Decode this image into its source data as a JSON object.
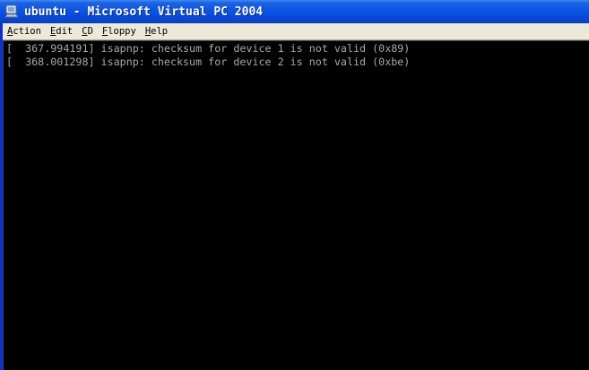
{
  "window": {
    "title": "ubuntu - Microsoft Virtual PC 2004",
    "app_icon": "virtual-pc-icon"
  },
  "menubar": {
    "items": [
      {
        "accel": "A",
        "rest": "ction"
      },
      {
        "accel": "E",
        "rest": "dit"
      },
      {
        "accel": "C",
        "rest": "D"
      },
      {
        "accel": "F",
        "rest": "loppy"
      },
      {
        "accel": "H",
        "rest": "elp"
      }
    ]
  },
  "console": {
    "lines": [
      "[  367.994191] isapnp: checksum for device 1 is not valid (0x89)",
      "[  368.001298] isapnp: checksum for device 2 is not valid (0xbe)"
    ],
    "text_color": "#a8a8a8",
    "background": "#000000"
  }
}
